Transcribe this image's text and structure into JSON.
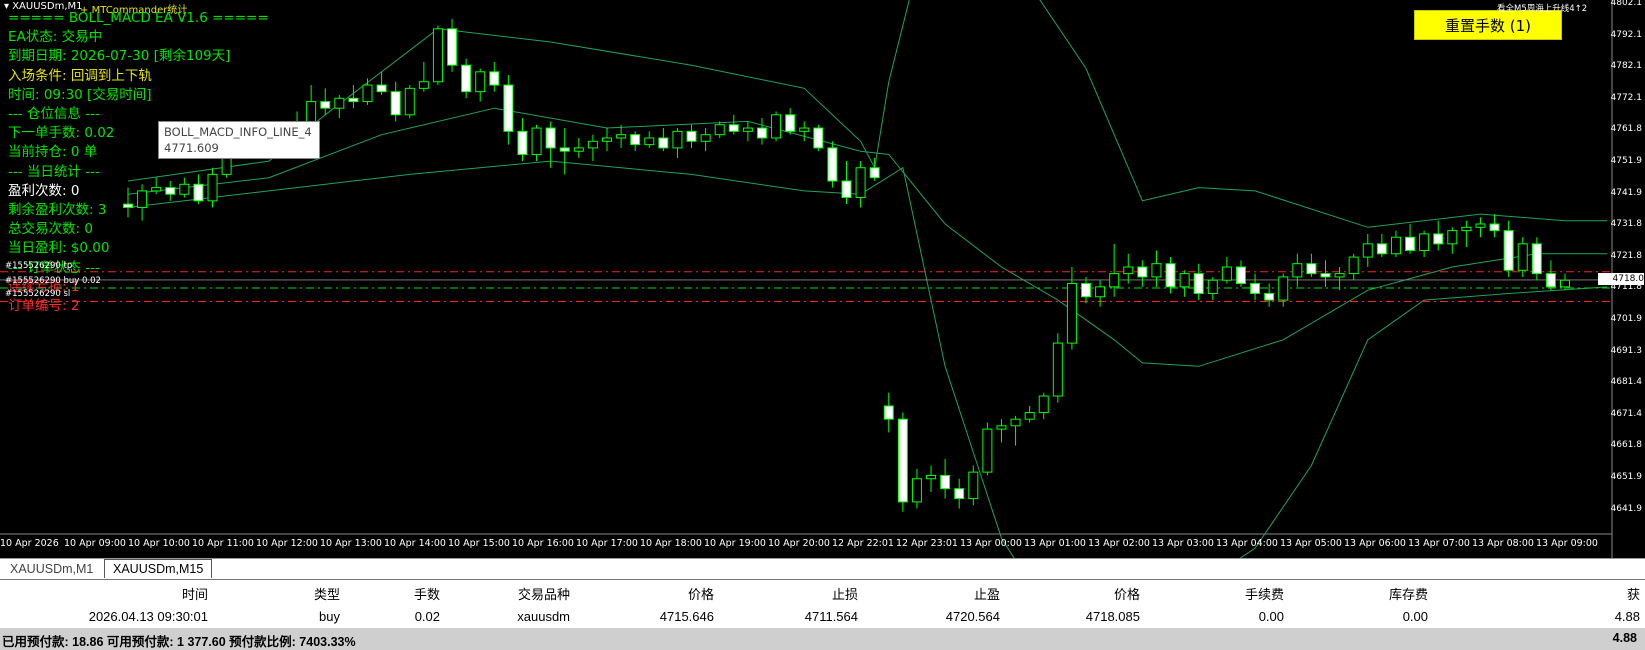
{
  "window": {
    "symbol_title": "XAUUSDm,M1",
    "mtcommander": "MTCommander统计",
    "top_right_note": "看全M5周海上升线4↑2",
    "reset_button": "重置手数 (1)"
  },
  "ea_panel": {
    "lines": [
      {
        "text": "===== BOLL_MACD EA V1.6 =====",
        "color": "green"
      },
      {
        "text": "EA状态: 交易中",
        "color": "green"
      },
      {
        "text": "到期日期: 2026-07-30 [剩余109天]",
        "color": "green"
      },
      {
        "text": "入场条件: 回调到上下轨",
        "color": "yellow"
      },
      {
        "text": "时间: 09:30 [交易时间]",
        "color": "green"
      },
      {
        "text": "--- 仓位信息 ---",
        "color": "green"
      },
      {
        "text": "下一单手数: 0.02",
        "color": "green"
      },
      {
        "text": "当前持仓: 0 单",
        "color": "green"
      },
      {
        "text": "--- 当日统计 ---",
        "color": "green"
      },
      {
        "text": "盈利次数: 0",
        "color": "white"
      },
      {
        "text": "剩余盈利次数: 3",
        "color": "green"
      },
      {
        "text": "总交易次数: 0",
        "color": "green"
      },
      {
        "text": "当日盈利: $0.00",
        "color": "green"
      },
      {
        "text": "--- 订单状态 ---",
        "color": "green"
      },
      {
        "text": "连续亏损: 1",
        "color": "red"
      },
      {
        "text": "订单编号: 2",
        "color": "red"
      }
    ],
    "tooltip_name": "BOLL_MACD_INFO_LINE_4",
    "tooltip_value": "4771.609"
  },
  "order_lines": {
    "tp_label": "#155526290 tp",
    "buy_label": "#155526290 buy 0.02",
    "sl_label": "#155526290 sl"
  },
  "colors": {
    "candle_up": "#000000",
    "candle_down": "#ffffff",
    "wick": "#00ff00",
    "bands": "#1fa35a",
    "order_line_red": "#ff2020",
    "order_line_green": "#00e000",
    "reset_button_bg": "#ffff00"
  },
  "price_axis": {
    "labels": [
      "4802.1",
      "4792.1",
      "4782.1",
      "4772.1",
      "4761.8",
      "4751.9",
      "4741.9",
      "4731.8",
      "4721.8",
      "4711.8",
      "4701.9",
      "4691.3",
      "4681.4",
      "4671.4",
      "4661.8",
      "4651.9",
      "4641.9"
    ],
    "current_price": "4718.0"
  },
  "time_axis": {
    "labels": [
      "10 Apr 2026",
      "10 Apr 09:00",
      "10 Apr 10:00",
      "10 Apr 11:00",
      "10 Apr 12:00",
      "10 Apr 13:00",
      "10 Apr 14:00",
      "10 Apr 15:00",
      "10 Apr 16:00",
      "10 Apr 17:00",
      "10 Apr 18:00",
      "10 Apr 19:00",
      "10 Apr 20:00",
      "12 Apr 22:01",
      "12 Apr 23:01",
      "13 Apr 00:00",
      "13 Apr 01:00",
      "13 Apr 02:00",
      "13 Apr 03:00",
      "13 Apr 04:00",
      "13 Apr 05:00",
      "13 Apr 06:00",
      "13 Apr 07:00",
      "13 Apr 08:00",
      "13 Apr 09:00"
    ]
  },
  "tabs": [
    "XAUUSDm,M1",
    "XAUUSDm,M15"
  ],
  "positions_table": {
    "headers": [
      "时间",
      "类型",
      "手数",
      "交易品种",
      "价格",
      "止损",
      "止盈",
      "价格",
      "手续费",
      "库存费",
      "获"
    ],
    "rows": [
      [
        "2026.04.13 09:30:01",
        "buy",
        "0.02",
        "xauusdm",
        "4715.646",
        "4711.564",
        "4720.564",
        "4718.085",
        "0.00",
        "0.00",
        "4.88"
      ]
    ]
  },
  "footer": {
    "summary": "已用预付款: 18.86  可用预付款: 1 377.60  预付款比例: 7403.33%",
    "total": "4.88"
  },
  "chart_data": {
    "type": "candlestick",
    "title": "XAUUSDm,M1",
    "ylim": [
      4641.9,
      4802.1
    ],
    "price_levels": {
      "tp": 4720.564,
      "open": 4715.646,
      "sl": 4711.564,
      "current": 4718.085
    },
    "candles": [
      [
        4741,
        4746,
        4737,
        4740
      ],
      [
        4740,
        4747,
        4736,
        4745
      ],
      [
        4745,
        4749,
        4744,
        4746
      ],
      [
        4746,
        4748,
        4742,
        4744
      ],
      [
        4744,
        4749,
        4743,
        4747
      ],
      [
        4747,
        4750,
        4741,
        4742
      ],
      [
        4742,
        4752,
        4740,
        4750
      ],
      [
        4750,
        4758,
        4749,
        4757
      ],
      [
        4757,
        4762,
        4756,
        4760
      ],
      [
        4760,
        4763,
        4757,
        4762
      ],
      [
        4762,
        4765,
        4760,
        4761
      ],
      [
        4761,
        4766,
        4759,
        4765
      ],
      [
        4765,
        4769,
        4762,
        4763
      ],
      [
        4763,
        4777,
        4762,
        4772
      ],
      [
        4772,
        4776,
        4768,
        4770
      ],
      [
        4770,
        4774,
        4767,
        4773
      ],
      [
        4773,
        4777,
        4770,
        4772
      ],
      [
        4772,
        4779,
        4771,
        4777
      ],
      [
        4777,
        4781,
        4774,
        4775
      ],
      [
        4775,
        4778,
        4766,
        4768
      ],
      [
        4768,
        4777,
        4767,
        4776
      ],
      [
        4776,
        4784,
        4775,
        4778
      ],
      [
        4778,
        4795,
        4777,
        4794
      ],
      [
        4794,
        4797,
        4781,
        4783
      ],
      [
        4783,
        4785,
        4773,
        4775
      ],
      [
        4775,
        4782,
        4772,
        4781
      ],
      [
        4781,
        4784,
        4775,
        4777
      ],
      [
        4777,
        4780,
        4759,
        4763
      ],
      [
        4763,
        4767,
        4754,
        4756
      ],
      [
        4756,
        4765,
        4754,
        4764
      ],
      [
        4764,
        4766,
        4752,
        4758
      ],
      [
        4758,
        4764,
        4750,
        4757
      ],
      [
        4757,
        4761,
        4755,
        4758
      ],
      [
        4758,
        4762,
        4754,
        4760
      ],
      [
        4760,
        4764,
        4757,
        4761
      ],
      [
        4761,
        4765,
        4758,
        4762
      ],
      [
        4762,
        4763,
        4757,
        4759
      ],
      [
        4759,
        4763,
        4758,
        4761
      ],
      [
        4761,
        4764,
        4757,
        4758
      ],
      [
        4758,
        4764,
        4755,
        4763
      ],
      [
        4763,
        4765,
        4758,
        4760
      ],
      [
        4760,
        4764,
        4757,
        4762
      ],
      [
        4762,
        4766,
        4761,
        4765
      ],
      [
        4765,
        4768,
        4762,
        4763
      ],
      [
        4763,
        4766,
        4760,
        4764
      ],
      [
        4764,
        4767,
        4759,
        4761
      ],
      [
        4761,
        4769,
        4760,
        4768
      ],
      [
        4768,
        4770,
        4762,
        4763
      ],
      [
        4763,
        4766,
        4760,
        4764
      ],
      [
        4764,
        4765,
        4757,
        4758
      ],
      [
        4758,
        4760,
        4746,
        4748
      ],
      [
        4748,
        4754,
        4741,
        4743
      ],
      [
        4743,
        4754,
        4740,
        4752
      ],
      [
        4752,
        4755,
        4748,
        4749
      ],
      [
        4680,
        4684,
        4672,
        4676
      ],
      [
        4676,
        4678,
        4648,
        4651
      ],
      [
        4651,
        4661,
        4649,
        4658
      ],
      [
        4658,
        4662,
        4654,
        4659
      ],
      [
        4659,
        4664,
        4652,
        4655
      ],
      [
        4655,
        4658,
        4649,
        4652
      ],
      [
        4652,
        4662,
        4650,
        4660
      ],
      [
        4660,
        4675,
        4659,
        4673
      ],
      [
        4673,
        4676,
        4669,
        4674
      ],
      [
        4674,
        4677,
        4668,
        4676
      ],
      [
        4676,
        4680,
        4675,
        4678
      ],
      [
        4678,
        4684,
        4676,
        4683
      ],
      [
        4683,
        4702,
        4681,
        4699
      ],
      [
        4699,
        4722,
        4697,
        4717
      ],
      [
        4717,
        4719,
        4711,
        4713
      ],
      [
        4713,
        4718,
        4710,
        4716
      ],
      [
        4716,
        4729,
        4713,
        4720
      ],
      [
        4720,
        4726,
        4717,
        4722
      ],
      [
        4722,
        4724,
        4716,
        4719
      ],
      [
        4719,
        4727,
        4716,
        4723
      ],
      [
        4723,
        4725,
        4714,
        4716
      ],
      [
        4716,
        4721,
        4713,
        4720
      ],
      [
        4720,
        4723,
        4712,
        4714
      ],
      [
        4714,
        4719,
        4712,
        4718
      ],
      [
        4718,
        4725,
        4717,
        4722
      ],
      [
        4722,
        4724,
        4716,
        4717
      ],
      [
        4717,
        4720,
        4712,
        4714
      ],
      [
        4714,
        4717,
        4710,
        4712
      ],
      [
        4712,
        4720,
        4710,
        4719
      ],
      [
        4719,
        4726,
        4716,
        4723
      ],
      [
        4723,
        4726,
        4719,
        4720
      ],
      [
        4720,
        4724,
        4716,
        4719
      ],
      [
        4719,
        4722,
        4715,
        4720
      ],
      [
        4720,
        4726,
        4718,
        4725
      ],
      [
        4725,
        4732,
        4722,
        4729
      ],
      [
        4729,
        4732,
        4725,
        4726
      ],
      [
        4726,
        4733,
        4725,
        4731
      ],
      [
        4731,
        4735,
        4726,
        4727
      ],
      [
        4727,
        4733,
        4725,
        4732
      ],
      [
        4732,
        4736,
        4727,
        4729
      ],
      [
        4729,
        4734,
        4726,
        4733
      ],
      [
        4733,
        4736,
        4728,
        4734
      ],
      [
        4734,
        4737,
        4731,
        4735
      ],
      [
        4735,
        4738,
        4731,
        4733
      ],
      [
        4733,
        4736,
        4719,
        4721
      ],
      [
        4721,
        4731,
        4719,
        4729
      ],
      [
        4729,
        4731,
        4718,
        4720
      ],
      [
        4720,
        4724,
        4715,
        4716
      ],
      [
        4716,
        4720,
        4715,
        4718
      ]
    ],
    "upper_band": [
      [
        0,
        4748
      ],
      [
        10,
        4754
      ],
      [
        14,
        4768
      ],
      [
        22,
        4794
      ],
      [
        30,
        4790
      ],
      [
        40,
        4783
      ],
      [
        48,
        4776
      ],
      [
        52,
        4760
      ],
      [
        53,
        4752
      ],
      [
        54,
        4778
      ],
      [
        57,
        4829
      ],
      [
        62,
        4820
      ],
      [
        68,
        4782
      ],
      [
        72,
        4742
      ],
      [
        76,
        4746
      ],
      [
        80,
        4745
      ],
      [
        88,
        4734
      ],
      [
        96,
        4738
      ],
      [
        102,
        4736
      ],
      [
        105,
        4736
      ]
    ],
    "middle_band": [
      [
        0,
        4744
      ],
      [
        10,
        4749
      ],
      [
        18,
        4762
      ],
      [
        26,
        4770
      ],
      [
        34,
        4764
      ],
      [
        44,
        4766
      ],
      [
        52,
        4757
      ],
      [
        54,
        4756
      ],
      [
        58,
        4735
      ],
      [
        62,
        4722
      ],
      [
        66,
        4712
      ],
      [
        70,
        4700
      ],
      [
        72,
        4693
      ],
      [
        76,
        4692
      ],
      [
        82,
        4700
      ],
      [
        88,
        4715
      ],
      [
        94,
        4722
      ],
      [
        100,
        4726
      ],
      [
        105,
        4726
      ]
    ],
    "lower_band": [
      [
        0,
        4740
      ],
      [
        10,
        4745
      ],
      [
        20,
        4750
      ],
      [
        30,
        4754
      ],
      [
        40,
        4750
      ],
      [
        48,
        4745
      ],
      [
        52,
        4744
      ],
      [
        55,
        4752
      ],
      [
        58,
        4692
      ],
      [
        62,
        4640
      ],
      [
        68,
        4600
      ],
      [
        74,
        4620
      ],
      [
        80,
        4637
      ],
      [
        84,
        4662
      ],
      [
        88,
        4700
      ],
      [
        92,
        4712
      ],
      [
        98,
        4714
      ],
      [
        105,
        4716
      ]
    ]
  }
}
